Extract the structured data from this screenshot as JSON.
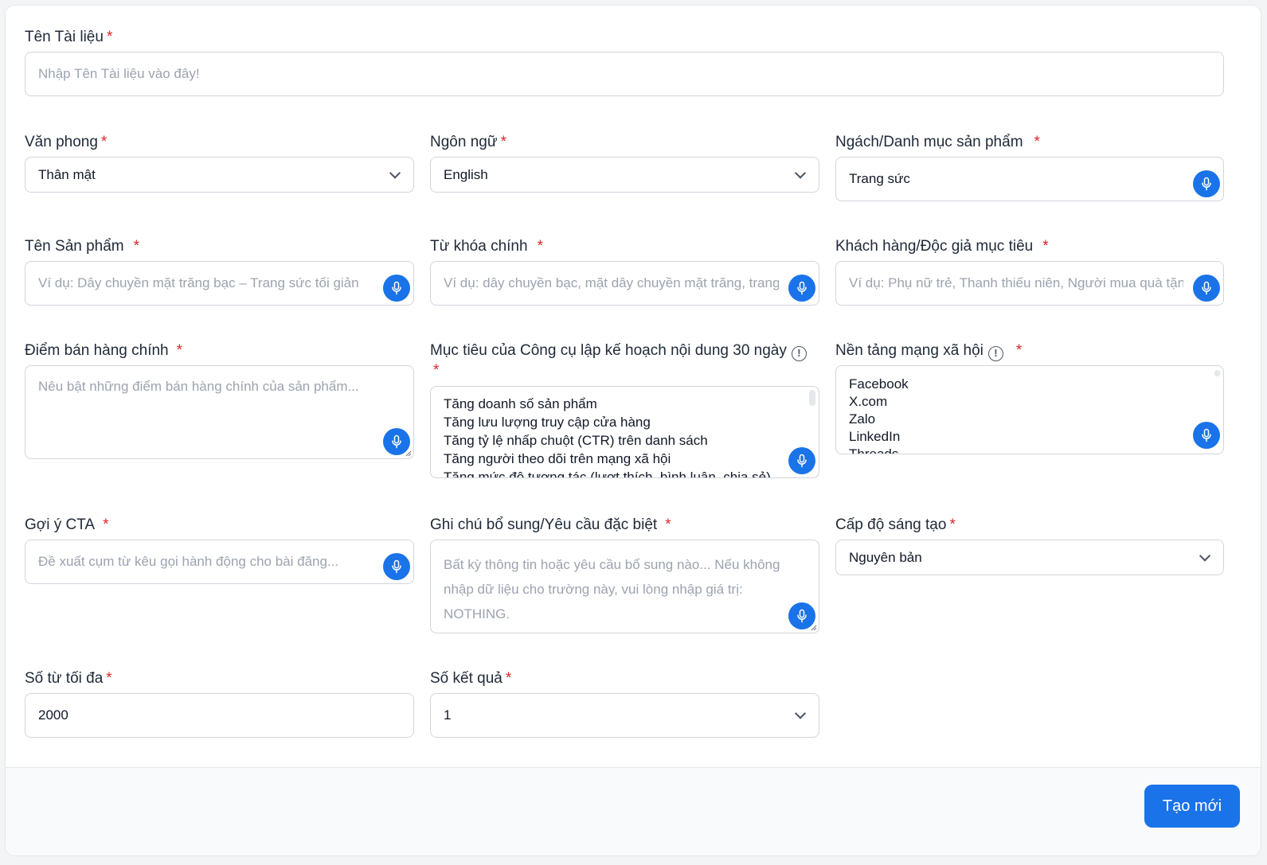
{
  "doc_name": {
    "label": "Tên Tài liệu",
    "placeholder": "Nhập Tên Tài liệu vào đây!"
  },
  "style": {
    "label": "Văn phong",
    "value": "Thân mật"
  },
  "language": {
    "label": "Ngôn ngữ",
    "value": "English"
  },
  "niche": {
    "label": "Ngách/Danh mục sản phẩm",
    "value": "Trang sức"
  },
  "product_name": {
    "label": "Tên Sản phẩm",
    "placeholder": "Ví dụ: Dây chuyền mặt trăng bạc – Trang sức tối giản"
  },
  "keywords": {
    "label": "Từ khóa chính",
    "placeholder": "Ví dụ: dây chuyền bạc, mặt dây chuyền mặt trăng, trang sức"
  },
  "audience": {
    "label": "Khách hàng/Độc giả mục tiêu",
    "placeholder": "Ví dụ: Phụ nữ trẻ, Thanh thiếu niên, Người mua quà tặng"
  },
  "selling_points": {
    "label": "Điểm bán hàng chính",
    "placeholder": "Nêu bật những điểm bán hàng chính của sản phẩm..."
  },
  "goals": {
    "label": "Mục tiêu của Công cụ lập kế hoạch nội dung 30 ngày",
    "items": [
      "Tăng doanh số sản phẩm",
      "Tăng lưu lượng truy cập cửa hàng",
      "Tăng tỷ lệ nhấp chuột (CTR) trên danh sách",
      "Tăng người theo dõi trên mạng xã hội",
      "Tăng mức độ tương tác (lượt thích, bình luận, chia sẻ)"
    ]
  },
  "platforms": {
    "label": "Nền tảng mạng xã hội",
    "items": [
      "Facebook",
      "X.com",
      "Zalo",
      "LinkedIn",
      "Threads"
    ]
  },
  "cta": {
    "label": "Gợi ý CTA",
    "placeholder": "Đề xuất cụm từ kêu gọi hành động cho bài đăng..."
  },
  "notes": {
    "label": "Ghi chú bổ sung/Yêu cầu đặc biệt",
    "placeholder_lines": [
      "Bất kỳ thông tin hoặc yêu cầu bổ sung nào... Nếu không",
      "nhập dữ liệu cho trường này, vui lòng nhập giá trị:",
      "NOTHING."
    ]
  },
  "creativity": {
    "label": "Cấp độ sáng tạo",
    "value": "Nguyên bản"
  },
  "max_words": {
    "label": "Số từ tối đa",
    "value": "2000"
  },
  "results": {
    "label": "Số kết quả",
    "value": "1"
  },
  "submit_label": "Tạo mới",
  "required_mark": "*",
  "info_mark": "!",
  "colors": {
    "accent": "#1a73e8",
    "required": "#dc2626",
    "border": "#d1d5db"
  }
}
